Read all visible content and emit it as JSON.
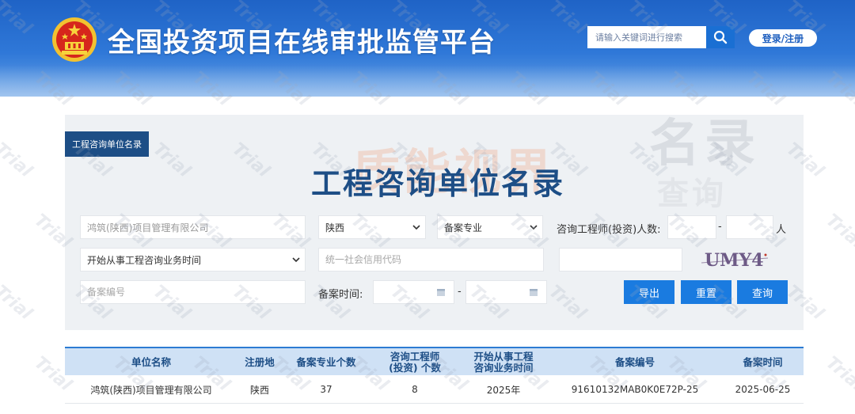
{
  "header": {
    "site_title": "全国投资项目在线审批监管平台",
    "search_placeholder": "请输入关键词进行搜索",
    "login_label": "登录/注册"
  },
  "panel": {
    "tag": "工程咨询单位名录",
    "title": "工程咨询单位名录",
    "deco_text": "名录",
    "deco_text2": "查询",
    "watermark": "质能视界"
  },
  "form": {
    "company_name_value": "鸿筑(陕西)项目管理有限公司",
    "region_value": "陕西",
    "specialty_value": "备案专业",
    "engineer_count_label": "咨询工程师(投资)人数:",
    "range_dash": "-",
    "unit_label": "人",
    "start_time_value": "开始从事工程咨询业务时间",
    "credit_code_placeholder": "统一社会信用代码",
    "record_no_placeholder": "备案编号",
    "record_time_label": "备案时间:",
    "date_dash": "-",
    "captcha_text": "UMY4",
    "buttons": {
      "export": "导出",
      "reset": "重置",
      "query": "查询"
    }
  },
  "table": {
    "headers": {
      "name": "单位名称",
      "region": "注册地",
      "specialty_count": "备案专业个数",
      "engineer_count_line1": "咨询工程师",
      "engineer_count_line2": "(投资) 个数",
      "start_time_line1": "开始从事工程",
      "start_time_line2": "咨询业务时间",
      "record_no": "备案编号",
      "record_time": "备案时间"
    },
    "rows": [
      {
        "name": "鸿筑(陕西)项目管理有限公司",
        "region": "陕西",
        "specialty_count": "37",
        "engineer_count": "8",
        "start_time": "2025年",
        "record_no": "91610132MAB0K0E72P-25",
        "record_time": "2025-06-25"
      }
    ]
  },
  "watermark_word": "Trial",
  "colors": {
    "header_blue": "#1f63c6",
    "title_navy": "#1d4e86",
    "button_blue": "#1a7be0",
    "table_head_bg": "#cfe1f5"
  }
}
